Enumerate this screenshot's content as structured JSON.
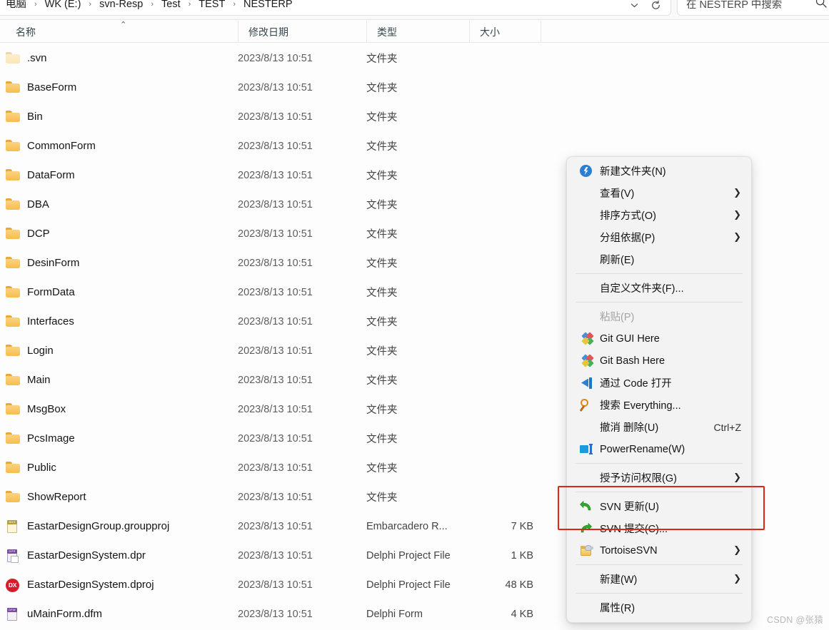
{
  "window": {
    "breadcrumb": [
      "电脑",
      "WK (E:)",
      "svn-Resp",
      "Test",
      "TEST",
      "NESTERP"
    ],
    "breadcrumb_separator": "›",
    "search_placeholder": "在 NESTERP 中搜索",
    "dropdown_icon": "chevron-down-icon",
    "refresh_icon": "refresh-icon",
    "search_icon": "search-icon"
  },
  "columns": {
    "name": "名称",
    "date_modified": "修改日期",
    "type": "类型",
    "size": "大小",
    "sort_indicator": "⌃"
  },
  "files": [
    {
      "name": ".svn",
      "date": "2023/8/13 10:51",
      "type": "文件夹",
      "size": "",
      "icon": "folder-hidden-icon"
    },
    {
      "name": "BaseForm",
      "date": "2023/8/13 10:51",
      "type": "文件夹",
      "size": "",
      "icon": "folder-icon"
    },
    {
      "name": "Bin",
      "date": "2023/8/13 10:51",
      "type": "文件夹",
      "size": "",
      "icon": "folder-icon"
    },
    {
      "name": "CommonForm",
      "date": "2023/8/13 10:51",
      "type": "文件夹",
      "size": "",
      "icon": "folder-icon"
    },
    {
      "name": "DataForm",
      "date": "2023/8/13 10:51",
      "type": "文件夹",
      "size": "",
      "icon": "folder-icon"
    },
    {
      "name": "DBA",
      "date": "2023/8/13 10:51",
      "type": "文件夹",
      "size": "",
      "icon": "folder-icon"
    },
    {
      "name": "DCP",
      "date": "2023/8/13 10:51",
      "type": "文件夹",
      "size": "",
      "icon": "folder-icon"
    },
    {
      "name": "DesinForm",
      "date": "2023/8/13 10:51",
      "type": "文件夹",
      "size": "",
      "icon": "folder-icon"
    },
    {
      "name": "FormData",
      "date": "2023/8/13 10:51",
      "type": "文件夹",
      "size": "",
      "icon": "folder-icon"
    },
    {
      "name": "Interfaces",
      "date": "2023/8/13 10:51",
      "type": "文件夹",
      "size": "",
      "icon": "folder-icon"
    },
    {
      "name": "Login",
      "date": "2023/8/13 10:51",
      "type": "文件夹",
      "size": "",
      "icon": "folder-icon"
    },
    {
      "name": "Main",
      "date": "2023/8/13 10:51",
      "type": "文件夹",
      "size": "",
      "icon": "folder-icon"
    },
    {
      "name": "MsgBox",
      "date": "2023/8/13 10:51",
      "type": "文件夹",
      "size": "",
      "icon": "folder-icon"
    },
    {
      "name": "PcsImage",
      "date": "2023/8/13 10:51",
      "type": "文件夹",
      "size": "",
      "icon": "folder-icon"
    },
    {
      "name": "Public",
      "date": "2023/8/13 10:51",
      "type": "文件夹",
      "size": "",
      "icon": "folder-icon"
    },
    {
      "name": "ShowReport",
      "date": "2023/8/13 10:51",
      "type": "文件夹",
      "size": "",
      "icon": "folder-icon"
    },
    {
      "name": "EastarDesignGroup.groupproj",
      "date": "2023/8/13 10:51",
      "type": "Embarcadero R...",
      "size": "7 KB",
      "icon": "groupproj-file-icon"
    },
    {
      "name": "EastarDesignSystem.dpr",
      "date": "2023/8/13 10:51",
      "type": "Delphi Project File",
      "size": "1 KB",
      "icon": "dpr-file-icon"
    },
    {
      "name": "EastarDesignSystem.dproj",
      "date": "2023/8/13 10:51",
      "type": "Delphi Project File",
      "size": "48 KB",
      "icon": "dproj-file-icon"
    },
    {
      "name": "uMainForm.dfm",
      "date": "2023/8/13 10:51",
      "type": "Delphi Form",
      "size": "4 KB",
      "icon": "dfm-file-icon"
    }
  ],
  "context_menu": [
    {
      "kind": "item",
      "label": "新建文件夹(N)",
      "icon": "new-folder-icon",
      "accel": "",
      "arrow": false,
      "disabled": false
    },
    {
      "kind": "item",
      "label": "查看(V)",
      "icon": "",
      "accel": "",
      "arrow": true,
      "disabled": false
    },
    {
      "kind": "item",
      "label": "排序方式(O)",
      "icon": "",
      "accel": "",
      "arrow": true,
      "disabled": false
    },
    {
      "kind": "item",
      "label": "分组依据(P)",
      "icon": "",
      "accel": "",
      "arrow": true,
      "disabled": false
    },
    {
      "kind": "item",
      "label": "刷新(E)",
      "icon": "",
      "accel": "",
      "arrow": false,
      "disabled": false
    },
    {
      "kind": "separator"
    },
    {
      "kind": "item",
      "label": "自定义文件夹(F)...",
      "icon": "",
      "accel": "",
      "arrow": false,
      "disabled": false
    },
    {
      "kind": "separator"
    },
    {
      "kind": "item",
      "label": "粘贴(P)",
      "icon": "",
      "accel": "",
      "arrow": false,
      "disabled": true
    },
    {
      "kind": "item",
      "label": "Git GUI Here",
      "icon": "git-gui-icon",
      "accel": "",
      "arrow": false,
      "disabled": false
    },
    {
      "kind": "item",
      "label": "Git Bash Here",
      "icon": "git-bash-icon",
      "accel": "",
      "arrow": false,
      "disabled": false
    },
    {
      "kind": "item",
      "label": "通过 Code 打开",
      "icon": "vscode-icon",
      "accel": "",
      "arrow": false,
      "disabled": false
    },
    {
      "kind": "item",
      "label": "搜索 Everything...",
      "icon": "everything-icon",
      "accel": "",
      "arrow": false,
      "disabled": false
    },
    {
      "kind": "item",
      "label": "撤消 删除(U)",
      "icon": "",
      "accel": "Ctrl+Z",
      "arrow": false,
      "disabled": false
    },
    {
      "kind": "item",
      "label": "PowerRename(W)",
      "icon": "powerrename-icon",
      "accel": "",
      "arrow": false,
      "disabled": false
    },
    {
      "kind": "separator"
    },
    {
      "kind": "item",
      "label": "授予访问权限(G)",
      "icon": "",
      "accel": "",
      "arrow": true,
      "disabled": false
    },
    {
      "kind": "separator"
    },
    {
      "kind": "item",
      "label": "SVN 更新(U)",
      "icon": "svn-update-icon",
      "accel": "",
      "arrow": false,
      "disabled": false,
      "highlighted": true
    },
    {
      "kind": "item",
      "label": "SVN 提交(C)...",
      "icon": "svn-commit-icon",
      "accel": "",
      "arrow": false,
      "disabled": false,
      "highlighted": true
    },
    {
      "kind": "item",
      "label": "TortoiseSVN",
      "icon": "tortoisesvn-icon",
      "accel": "",
      "arrow": true,
      "disabled": false
    },
    {
      "kind": "separator"
    },
    {
      "kind": "item",
      "label": "新建(W)",
      "icon": "",
      "accel": "",
      "arrow": true,
      "disabled": false
    },
    {
      "kind": "separator"
    },
    {
      "kind": "item",
      "label": "属性(R)",
      "icon": "",
      "accel": "",
      "arrow": false,
      "disabled": false
    }
  ],
  "annotation": {
    "highlight_color": "#e2231a"
  },
  "watermark": "CSDN @张猿"
}
